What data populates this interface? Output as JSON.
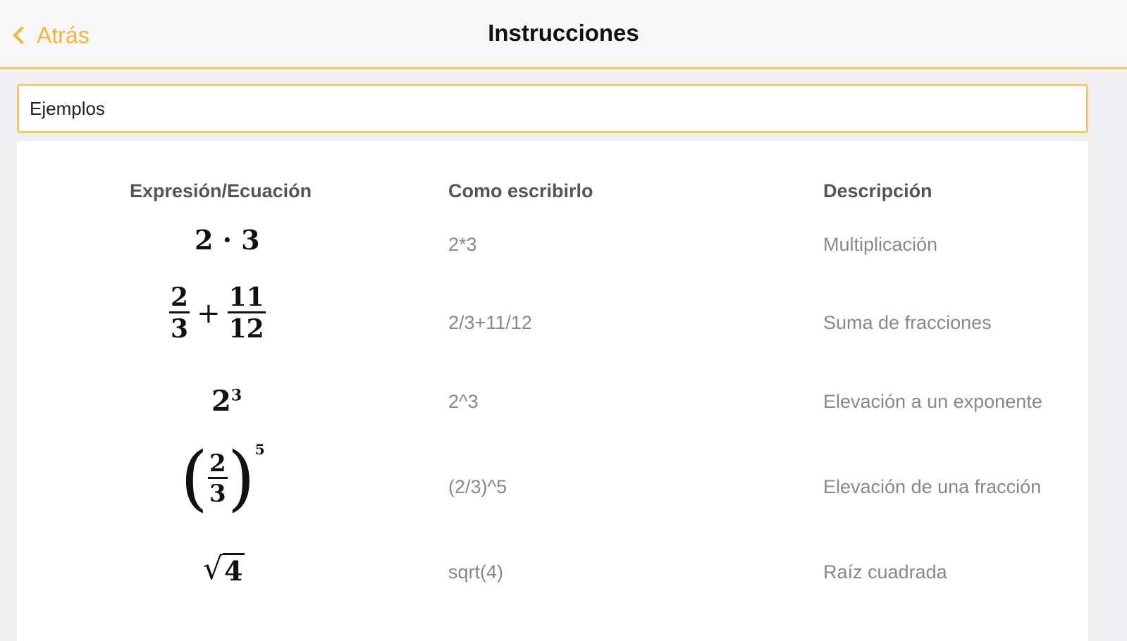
{
  "navbar": {
    "back_label": "Atrás",
    "title": "Instrucciones"
  },
  "section": {
    "title": "Ejemplos"
  },
  "table": {
    "headers": [
      "Expresión/Ecuación",
      "Como escribirlo",
      "Descripción"
    ],
    "rows": [
      {
        "code": "2*3",
        "description": "Multiplicación"
      },
      {
        "code": "2/3+11/12",
        "description": "Suma de fracciones"
      },
      {
        "code": "2^3",
        "description": "Elevación a un exponente"
      },
      {
        "code": "(2/3)^5",
        "description": "Elevación de una fracción"
      },
      {
        "code": "sqrt(4)",
        "description": "Raíz cuadrada"
      }
    ]
  },
  "expressions": {
    "r0": {
      "a": "2",
      "op": "·",
      "b": "3"
    },
    "r1": {
      "n1": "2",
      "d1": "3",
      "op": "+",
      "n2": "11",
      "d2": "12"
    },
    "r2": {
      "base": "2",
      "exp": "3"
    },
    "r3": {
      "n": "2",
      "d": "3",
      "exp": "5"
    },
    "r4": {
      "radicand": "4"
    }
  }
}
